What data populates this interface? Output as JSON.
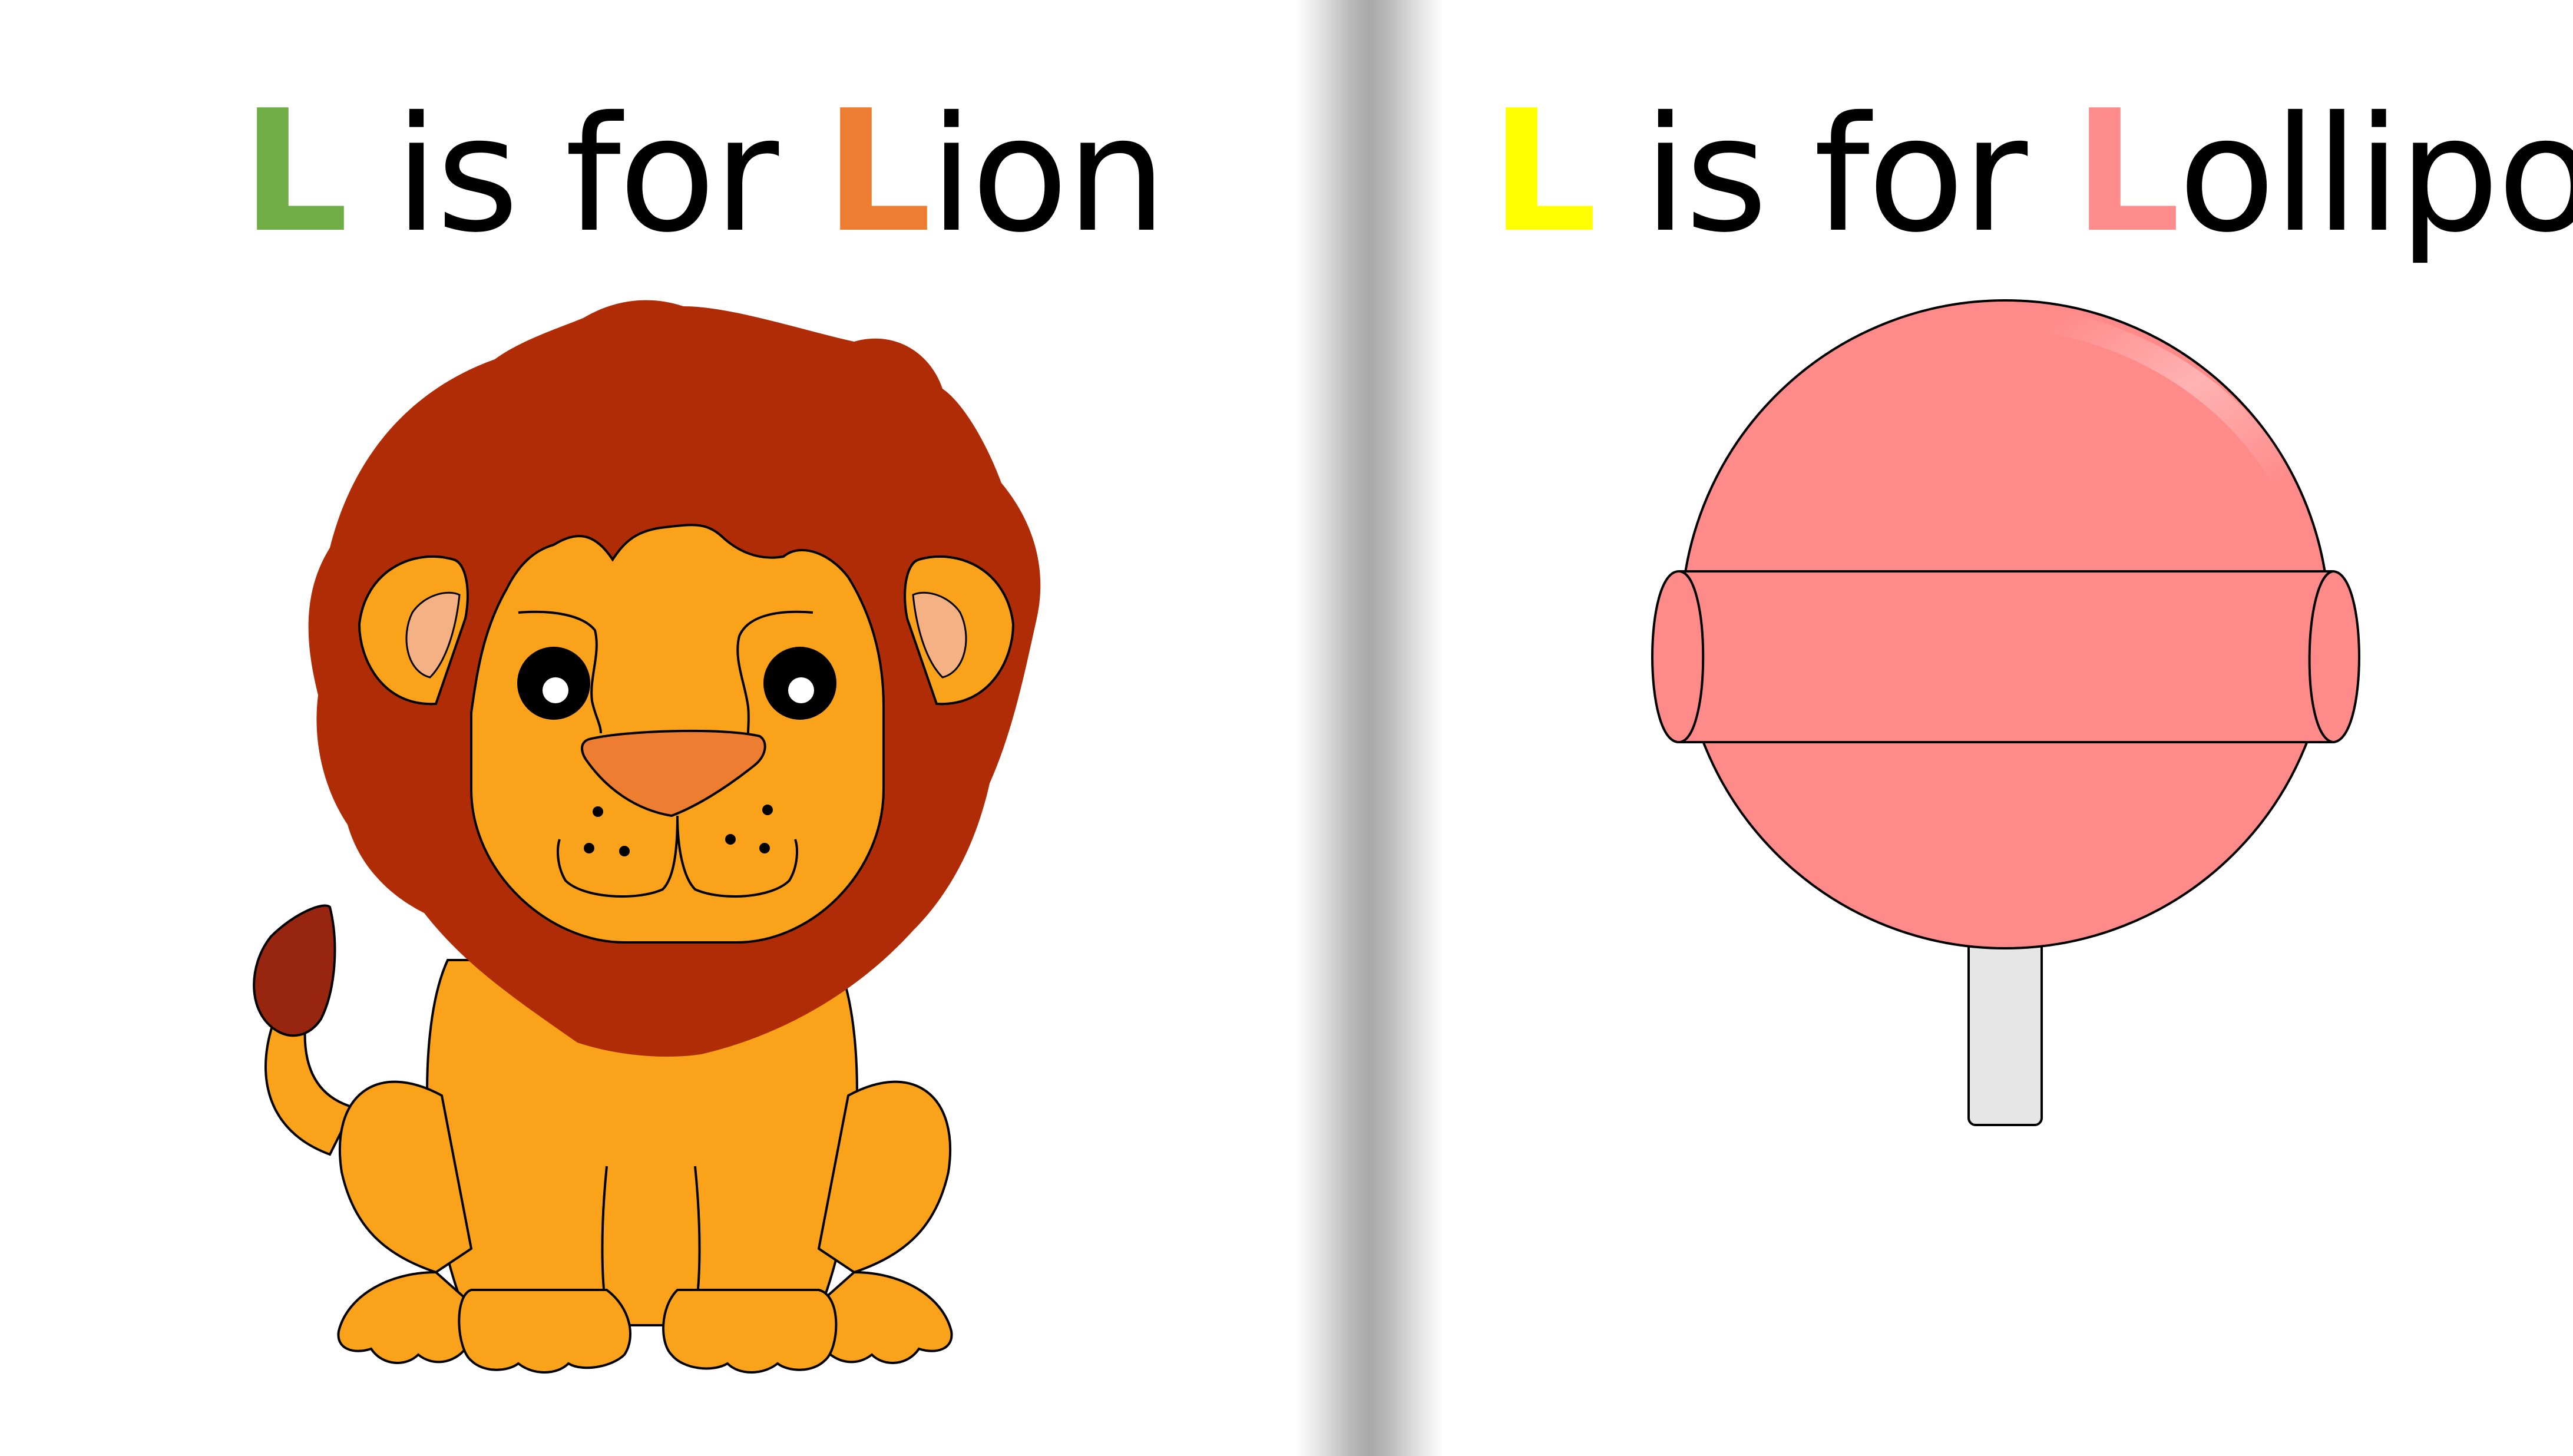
{
  "colors": {
    "left_initial": "#70ad47",
    "lion_initial": "#ed7d31",
    "right_initial": "#ffff00",
    "lollipop_initial": "#ff8c8c",
    "mane": "#b02c06",
    "lion_body": "#faa21a",
    "candy": "#ff8a8a",
    "stick": "#e6e6e6"
  },
  "left_page": {
    "initial": "L",
    "middle": " is for ",
    "word_initial": "L",
    "word_rest": "ion"
  },
  "right_page": {
    "initial": "L",
    "middle": " is for ",
    "word_initial": "L",
    "word_rest": "ollipop"
  },
  "icons": {
    "left_picture": "lion-illustration",
    "right_picture": "lollipop-illustration"
  }
}
